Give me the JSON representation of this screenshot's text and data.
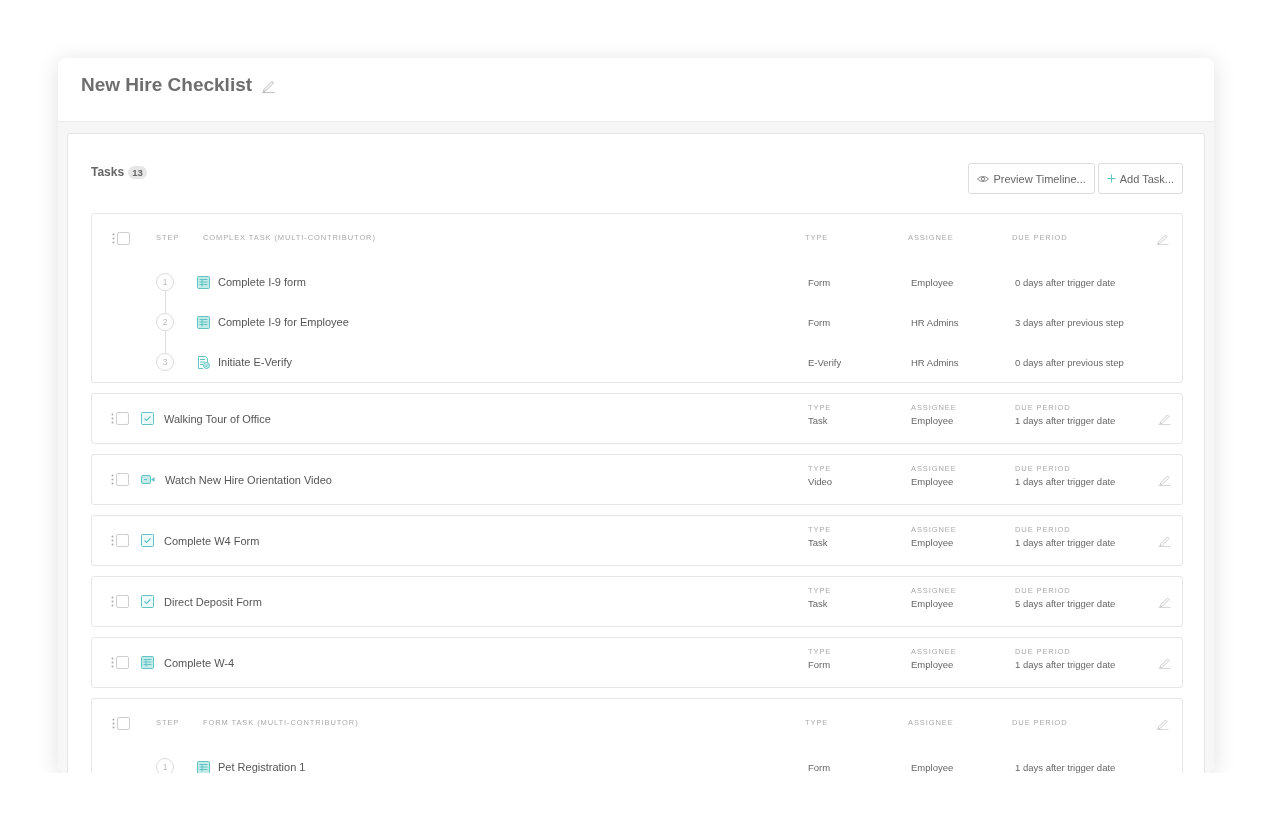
{
  "header": {
    "title": "New Hire Checklist"
  },
  "tasks_panel": {
    "title": "Tasks",
    "count": "13",
    "buttons": [
      {
        "kind": "preview",
        "label": "Preview Timeline..."
      },
      {
        "kind": "add",
        "label": "Add Task..."
      }
    ]
  },
  "tasks": [
    {
      "kind": "group",
      "checked": false,
      "headers": {
        "step": "STEP",
        "title": "COMPLEX TASK (MULTI-CONTRIBUTOR)",
        "type": "TYPE",
        "assignee": "ASSIGNEE",
        "due_period": "DUE PERIOD"
      },
      "steps": [
        {
          "number": "1",
          "kind": "form",
          "name": "Complete I-9 form",
          "type": "Form",
          "assignee": "Employee",
          "due_period": "0 days after trigger date"
        },
        {
          "number": "2",
          "kind": "form",
          "name": "Complete I-9 for Employee",
          "type": "Form",
          "assignee": "HR Admins",
          "due_period": "3 days after previous step"
        },
        {
          "number": "3",
          "kind": "verify",
          "name": "Initiate E-Verify",
          "type": "E-Verify",
          "assignee": "HR Admins",
          "due_period": "0 days after previous step"
        }
      ]
    },
    {
      "kind": "checklist",
      "checked": false,
      "name": "Walking Tour of Office",
      "type": {
        "label": "TYPE",
        "value": "Task"
      },
      "assignee": {
        "label": "ASSIGNEE",
        "value": "Employee"
      },
      "due_period": {
        "label": "DUE PERIOD",
        "value": "1 days after trigger date"
      }
    },
    {
      "kind": "video",
      "checked": false,
      "name": "Watch New Hire Orientation Video",
      "type": {
        "label": "TYPE",
        "value": "Video"
      },
      "assignee": {
        "label": "ASSIGNEE",
        "value": "Employee"
      },
      "due_period": {
        "label": "DUE PERIOD",
        "value": "1 days after trigger date"
      }
    },
    {
      "kind": "checklist",
      "checked": false,
      "name": "Complete W4 Form",
      "type": {
        "label": "TYPE",
        "value": "Task"
      },
      "assignee": {
        "label": "ASSIGNEE",
        "value": "Employee"
      },
      "due_period": {
        "label": "DUE PERIOD",
        "value": "1 days after trigger date"
      }
    },
    {
      "kind": "checklist",
      "checked": false,
      "name": "Direct Deposit Form",
      "type": {
        "label": "TYPE",
        "value": "Task"
      },
      "assignee": {
        "label": "ASSIGNEE",
        "value": "Employee"
      },
      "due_period": {
        "label": "DUE PERIOD",
        "value": "5 days after trigger date"
      }
    },
    {
      "kind": "form",
      "checked": false,
      "name": "Complete W-4",
      "type": {
        "label": "TYPE",
        "value": "Form"
      },
      "assignee": {
        "label": "ASSIGNEE",
        "value": "Employee"
      },
      "due_period": {
        "label": "DUE PERIOD",
        "value": "1 days after trigger date"
      }
    },
    {
      "kind": "group",
      "checked": false,
      "headers": {
        "step": "STEP",
        "title": "FORM TASK (MULTI-CONTRIBUTOR)",
        "type": "TYPE",
        "assignee": "ASSIGNEE",
        "due_period": "DUE PERIOD"
      },
      "steps": [
        {
          "number": "1",
          "kind": "form",
          "name": "Pet Registration 1",
          "type": "Form",
          "assignee": "Employee",
          "due_period": "1 days after trigger date"
        }
      ]
    }
  ]
}
